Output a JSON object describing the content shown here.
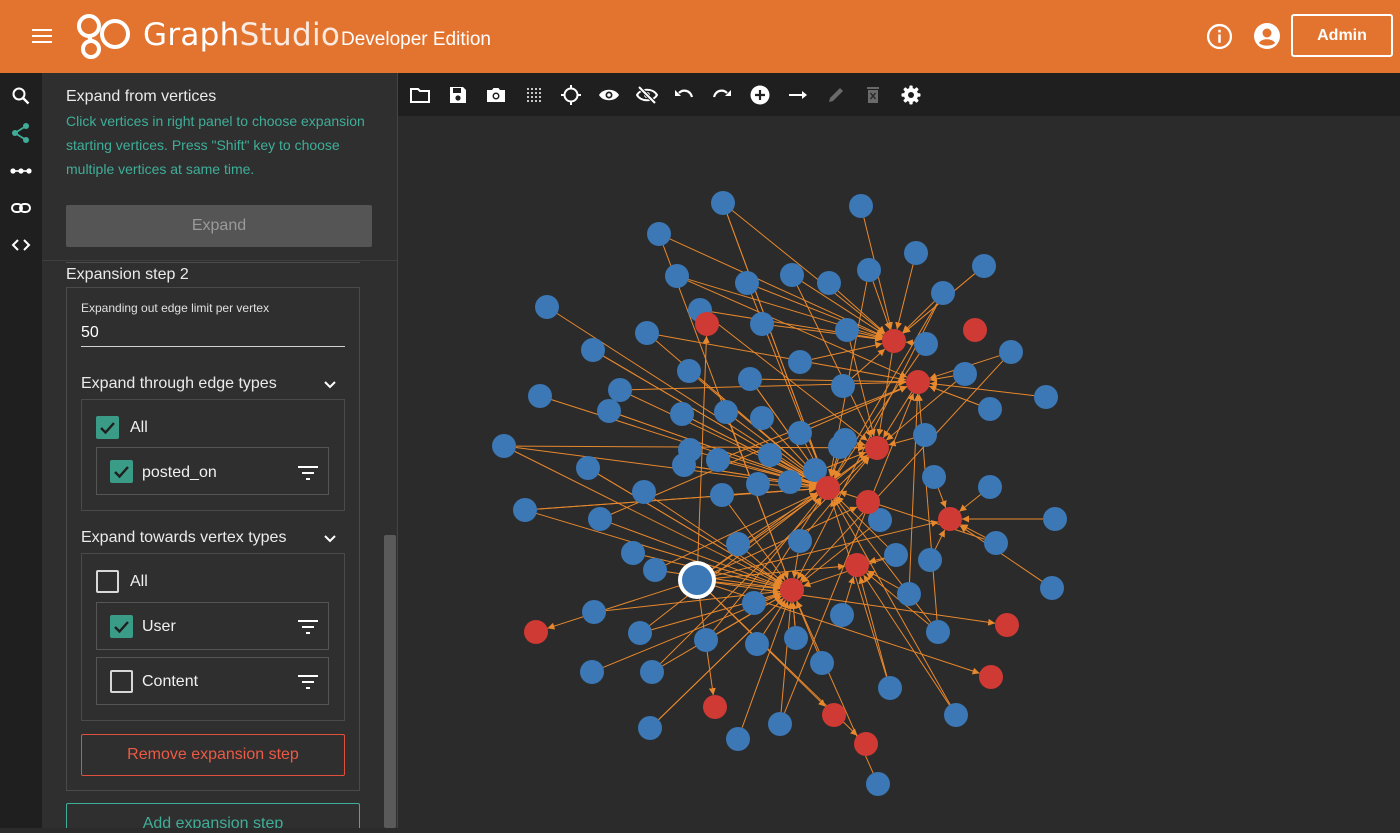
{
  "header": {
    "brand_part1": "Graph",
    "brand_part2": "Studio",
    "edition": "Developer Edition",
    "admin_label": "Admin",
    "color": "#e37430"
  },
  "sidebar_icons": [
    "search-icon",
    "share-icon",
    "path-icon",
    "link-icon",
    "code-icon"
  ],
  "panel": {
    "title": "Expand from vertices",
    "help": "Click vertices in right panel to choose expansion starting vertices. Press \"Shift\" key to choose multiple vertices at same time.",
    "expand_label": "Expand",
    "step_title": "Expansion step 2",
    "limit_label": "Expanding out edge limit per vertex",
    "limit_value": "50",
    "edge_types": {
      "title": "Expand through edge types",
      "all_label": "All",
      "all_checked": true,
      "items": [
        {
          "label": "posted_on",
          "checked": true
        }
      ]
    },
    "vertex_types": {
      "title": "Expand towards vertex types",
      "all_label": "All",
      "all_checked": false,
      "items": [
        {
          "label": "User",
          "checked": true
        },
        {
          "label": "Content",
          "checked": false
        }
      ]
    },
    "remove_label": "Remove expansion step",
    "add_label": "Add expansion step"
  },
  "toolbar_icons": [
    "folder-icon",
    "save-icon",
    "camera-icon",
    "grid-icon",
    "locate-icon",
    "eye-icon",
    "eye-off-icon",
    "undo-icon",
    "redo-icon",
    "add-vertex-icon",
    "add-edge-icon",
    "edit-icon",
    "delete-icon",
    "settings-icon"
  ],
  "graph": {
    "colors": {
      "user": "#3b78b5",
      "content": "#cf3a34",
      "edge": "#e8882d",
      "selected_ring": "#ffffff"
    },
    "user_vertex_count": 79,
    "content_vertex_count": 16,
    "selected_vertex": "user"
  }
}
